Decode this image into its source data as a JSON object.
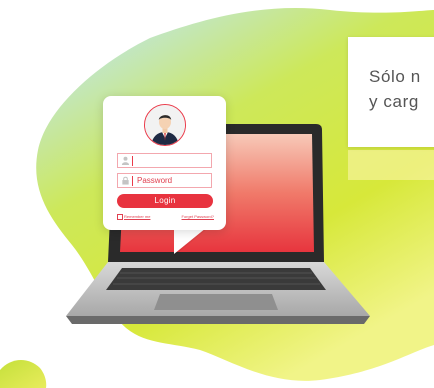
{
  "promo": {
    "line1": "Sólo n",
    "line2": "y carg"
  },
  "login": {
    "username_placeholder": "",
    "password_placeholder": "Password",
    "login_label": "Login",
    "remember_label": "Remember me",
    "forgot_label": "Forget Password?"
  },
  "colors": {
    "accent": "#e8333f",
    "blob_green": "#c7e03a",
    "blob_teal": "#9fd9d2",
    "blob_yellow": "#f3f17a"
  },
  "icons": {
    "avatar": "businessman-avatar-icon",
    "user": "user-icon",
    "password": "lock-icon"
  }
}
